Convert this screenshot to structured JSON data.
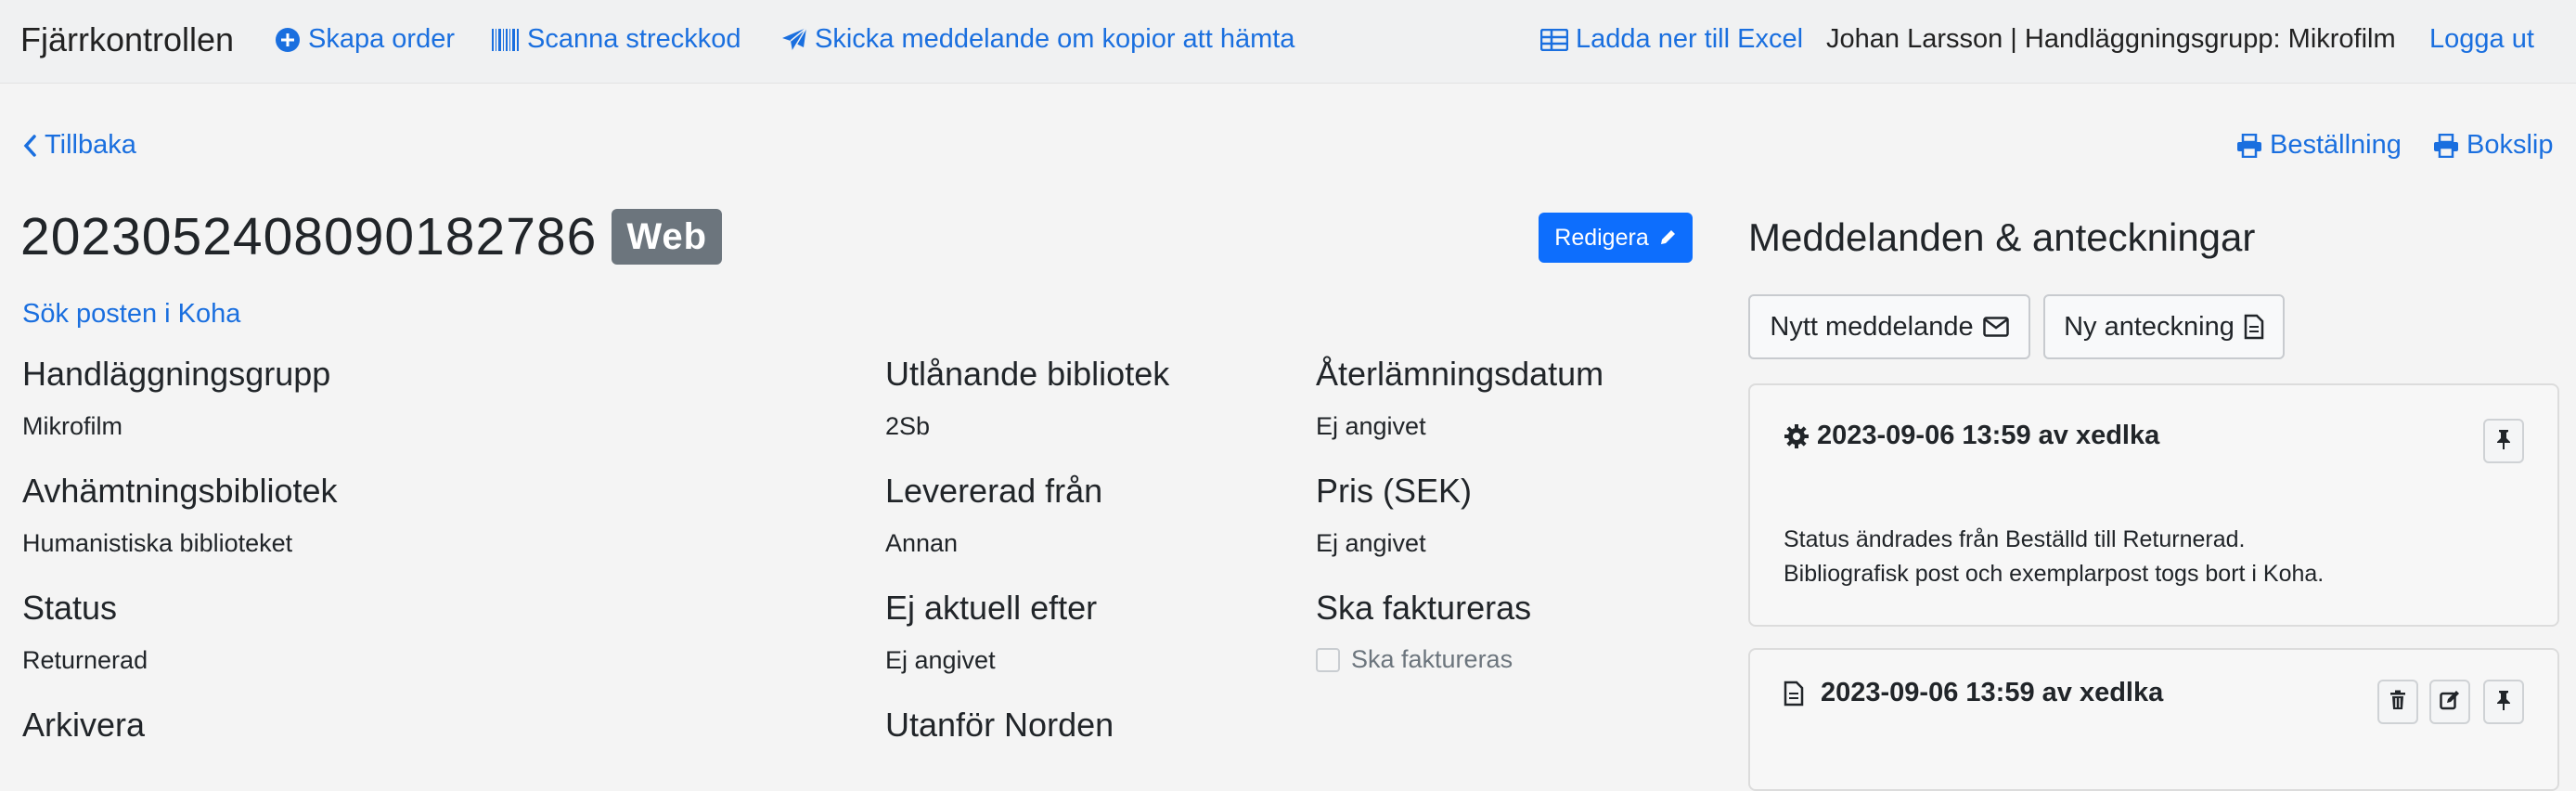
{
  "nav": {
    "brand": "Fjärrkontrollen",
    "create_order": "Skapa order",
    "scan_barcode": "Scanna streckkod",
    "send_message": "Skicka meddelande om kopior att hämta",
    "download_excel": "Ladda ner till Excel",
    "user_info": "Johan Larsson | Handläggningsgrupp: Mikrofilm",
    "logout": "Logga ut"
  },
  "back_link": "Tillbaka",
  "print": {
    "order": "Beställning",
    "bookslip": "Bokslip"
  },
  "order": {
    "number": "2023052408090182786",
    "badge": "Web",
    "edit_label": "Redigera",
    "koha_link": "Sök posten i Koha"
  },
  "fields": {
    "handling_group": {
      "label": "Handläggningsgrupp",
      "value": "Mikrofilm"
    },
    "pickup_library": {
      "label": "Avhämtningsbibliotek",
      "value": "Humanistiska biblioteket"
    },
    "status": {
      "label": "Status",
      "value": "Returnerad"
    },
    "archive": {
      "label": "Arkivera"
    },
    "lending_library": {
      "label": "Utlånande bibliotek",
      "value": "2Sb"
    },
    "delivered_from": {
      "label": "Levererad från",
      "value": "Annan"
    },
    "not_current_after": {
      "label": "Ej aktuell efter",
      "value": "Ej angivet"
    },
    "outside_nordic": {
      "label": "Utanför Norden"
    },
    "return_date": {
      "label": "Återlämningsdatum",
      "value": "Ej angivet"
    },
    "price": {
      "label": "Pris (SEK)",
      "value": "Ej angivet"
    },
    "invoice": {
      "label": "Ska faktureras",
      "checkbox_label": "Ska faktureras",
      "checked": false
    }
  },
  "messages": {
    "heading": "Meddelanden & anteckningar",
    "new_message": "Nytt meddelande",
    "new_note": "Ny anteckning",
    "entries": [
      {
        "type": "system",
        "header": "2023-09-06 13:59 av xedlka",
        "line1": "Status ändrades från Beställd till Returnerad.",
        "line2": "Bibliografisk post och exemplarpost togs bort i Koha."
      },
      {
        "type": "note",
        "header": "2023-09-06 13:59 av xedlka"
      }
    ]
  },
  "colors": {
    "link": "#1a6fdf",
    "primary": "#0d6efd",
    "badge": "#6c757d"
  }
}
